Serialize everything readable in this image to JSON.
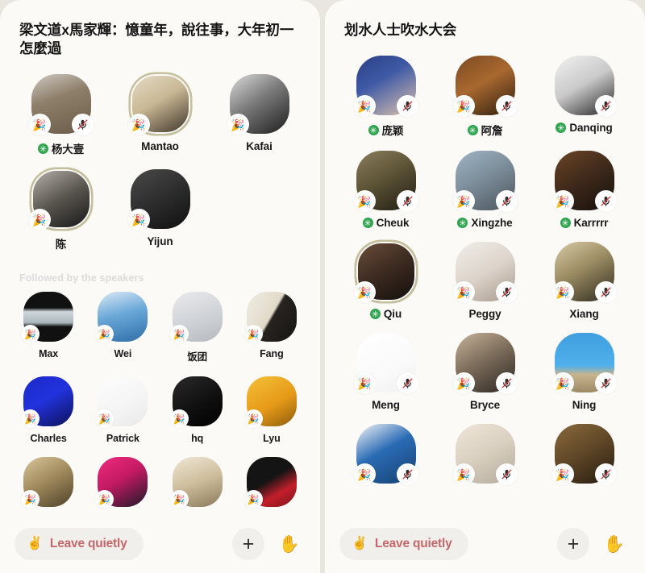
{
  "theme": {
    "page_bg": "#e9e6df",
    "panel_bg": "#fbfaf7",
    "accent_leave": "#c4676b",
    "badge_green": "#2fa44f",
    "speaking_ring": "#c6bf9c",
    "section_label_color": "#dcdcdc"
  },
  "rooms": [
    {
      "title": "梁文道x馬家輝：憶童年，說往事，大年初一怎麼過",
      "stage": [
        {
          "name": "杨大壹",
          "verified": true,
          "muted": true,
          "party": true,
          "speaking": false,
          "img": "cat-tabby"
        },
        {
          "name": "Mantao",
          "verified": false,
          "muted": false,
          "party": true,
          "speaking": true,
          "img": "man-suit-room"
        },
        {
          "name": "Kafai",
          "verified": false,
          "muted": false,
          "party": true,
          "speaking": false,
          "img": "bw-portrait"
        },
        {
          "name": "陈",
          "verified": false,
          "muted": false,
          "party": true,
          "speaking": true,
          "img": "man-black-shirt"
        },
        {
          "name": "Yijun",
          "verified": false,
          "muted": false,
          "party": true,
          "speaking": false,
          "img": "bw-woman"
        }
      ],
      "section_label": "Followed by the speakers",
      "followers": [
        {
          "name": "Max",
          "party": true,
          "img": "silhouette-sea"
        },
        {
          "name": "Wei",
          "party": true,
          "img": "kids-blue"
        },
        {
          "name": "饭团",
          "party": true,
          "img": "white-cat"
        },
        {
          "name": "Fang",
          "party": true,
          "img": "woman-presenting"
        },
        {
          "name": "Charles",
          "party": true,
          "img": "blue-room"
        },
        {
          "name": "Patrick",
          "party": true,
          "img": "sketch-drawing"
        },
        {
          "name": "hq",
          "party": true,
          "img": "dark-bw"
        },
        {
          "name": "Lyu",
          "party": true,
          "img": "yellow-fruit"
        },
        {
          "name": "",
          "party": true,
          "img": "gold-figure"
        },
        {
          "name": "",
          "party": true,
          "img": "pink-hero"
        },
        {
          "name": "",
          "party": true,
          "img": "landscape-painting"
        },
        {
          "name": "",
          "party": true,
          "img": "red-dress-woman"
        }
      ],
      "toolbar": {
        "leave_label": "Leave quietly",
        "leave_emoji": "✌",
        "plus_label": "+",
        "hand_emoji": "✋"
      }
    },
    {
      "title": "划水人士吹水大会",
      "stage": [
        {
          "name": "庞颖",
          "verified": true,
          "muted": true,
          "party": true,
          "speaking": false,
          "img": "glasses-woman-g"
        },
        {
          "name": "阿詹",
          "verified": true,
          "muted": true,
          "party": true,
          "speaking": false,
          "img": "woman-bookshelf"
        },
        {
          "name": "Danqing",
          "verified": true,
          "muted": true,
          "party": false,
          "speaking": false,
          "img": "dark-hair-white"
        },
        {
          "name": "Cheuk",
          "verified": true,
          "muted": true,
          "party": true,
          "speaking": false,
          "img": "person-dog"
        },
        {
          "name": "Xingzhe",
          "verified": true,
          "muted": true,
          "party": true,
          "speaking": false,
          "img": "cat-grey-sofa"
        },
        {
          "name": "Karrrrr",
          "verified": true,
          "muted": true,
          "party": true,
          "speaking": false,
          "img": "woman-dinner"
        },
        {
          "name": "Qiu",
          "verified": true,
          "muted": false,
          "party": true,
          "speaking": true,
          "img": "man-glasses-food"
        },
        {
          "name": "Peggy",
          "verified": false,
          "muted": true,
          "party": true,
          "speaking": false,
          "img": "woman-scarf"
        },
        {
          "name": "Xiang",
          "verified": false,
          "muted": true,
          "party": true,
          "speaking": false,
          "img": "man-boxes"
        },
        {
          "name": "Meng",
          "verified": false,
          "muted": true,
          "party": true,
          "speaking": false,
          "img": "meme-sketch"
        },
        {
          "name": "Bryce",
          "verified": false,
          "muted": true,
          "party": true,
          "speaking": false,
          "img": "cat-phone"
        },
        {
          "name": "Ning",
          "verified": false,
          "muted": true,
          "party": true,
          "speaking": false,
          "img": "person-blue-sky"
        },
        {
          "name": "",
          "verified": false,
          "muted": true,
          "party": true,
          "speaking": false,
          "img": "blue-scarf-sunglasses"
        },
        {
          "name": "",
          "verified": false,
          "muted": true,
          "party": true,
          "speaking": false,
          "img": "woman-laptop"
        },
        {
          "name": "",
          "verified": false,
          "muted": true,
          "party": true,
          "speaking": false,
          "img": "woman-temple"
        }
      ],
      "toolbar": {
        "leave_label": "Leave quietly",
        "leave_emoji": "✌",
        "plus_label": "+",
        "hand_emoji": "✋"
      }
    }
  ]
}
